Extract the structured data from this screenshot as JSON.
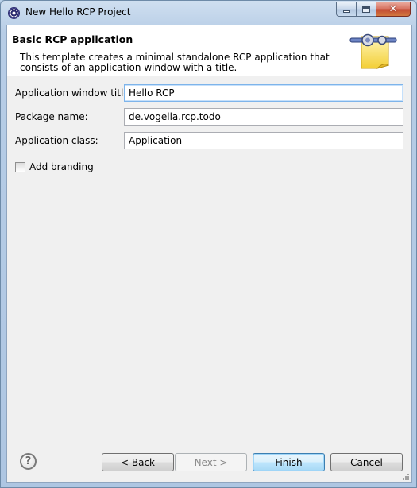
{
  "window": {
    "title": "New Hello RCP Project",
    "icon": "eclipse-icon",
    "controls": [
      "minimize-icon",
      "maximize-icon",
      "close-icon"
    ]
  },
  "header": {
    "heading": "Basic RCP application",
    "description": "This template creates a minimal standalone RCP application that consists of an application window with a title.",
    "icon": "plugin-wizard-icon"
  },
  "form": {
    "window_title_label": "Application window title:",
    "window_title_value": "Hello RCP",
    "package_label": "Package name:",
    "package_value": "de.vogella.rcp.todo",
    "class_label": "Application class:",
    "class_value": "Application",
    "branding_label": "Add branding",
    "branding_checked": false
  },
  "footer": {
    "help_icon": "help-icon",
    "back_label": "< Back",
    "next_label": "Next >",
    "finish_label": "Finish",
    "cancel_label": "Cancel"
  },
  "colors": {
    "frame": "#b9d1ea",
    "dialog_background": "#f0f0f0",
    "banner_background": "#ffffff",
    "close_button": "#c24a33",
    "default_button_border": "#3c7fb1"
  }
}
